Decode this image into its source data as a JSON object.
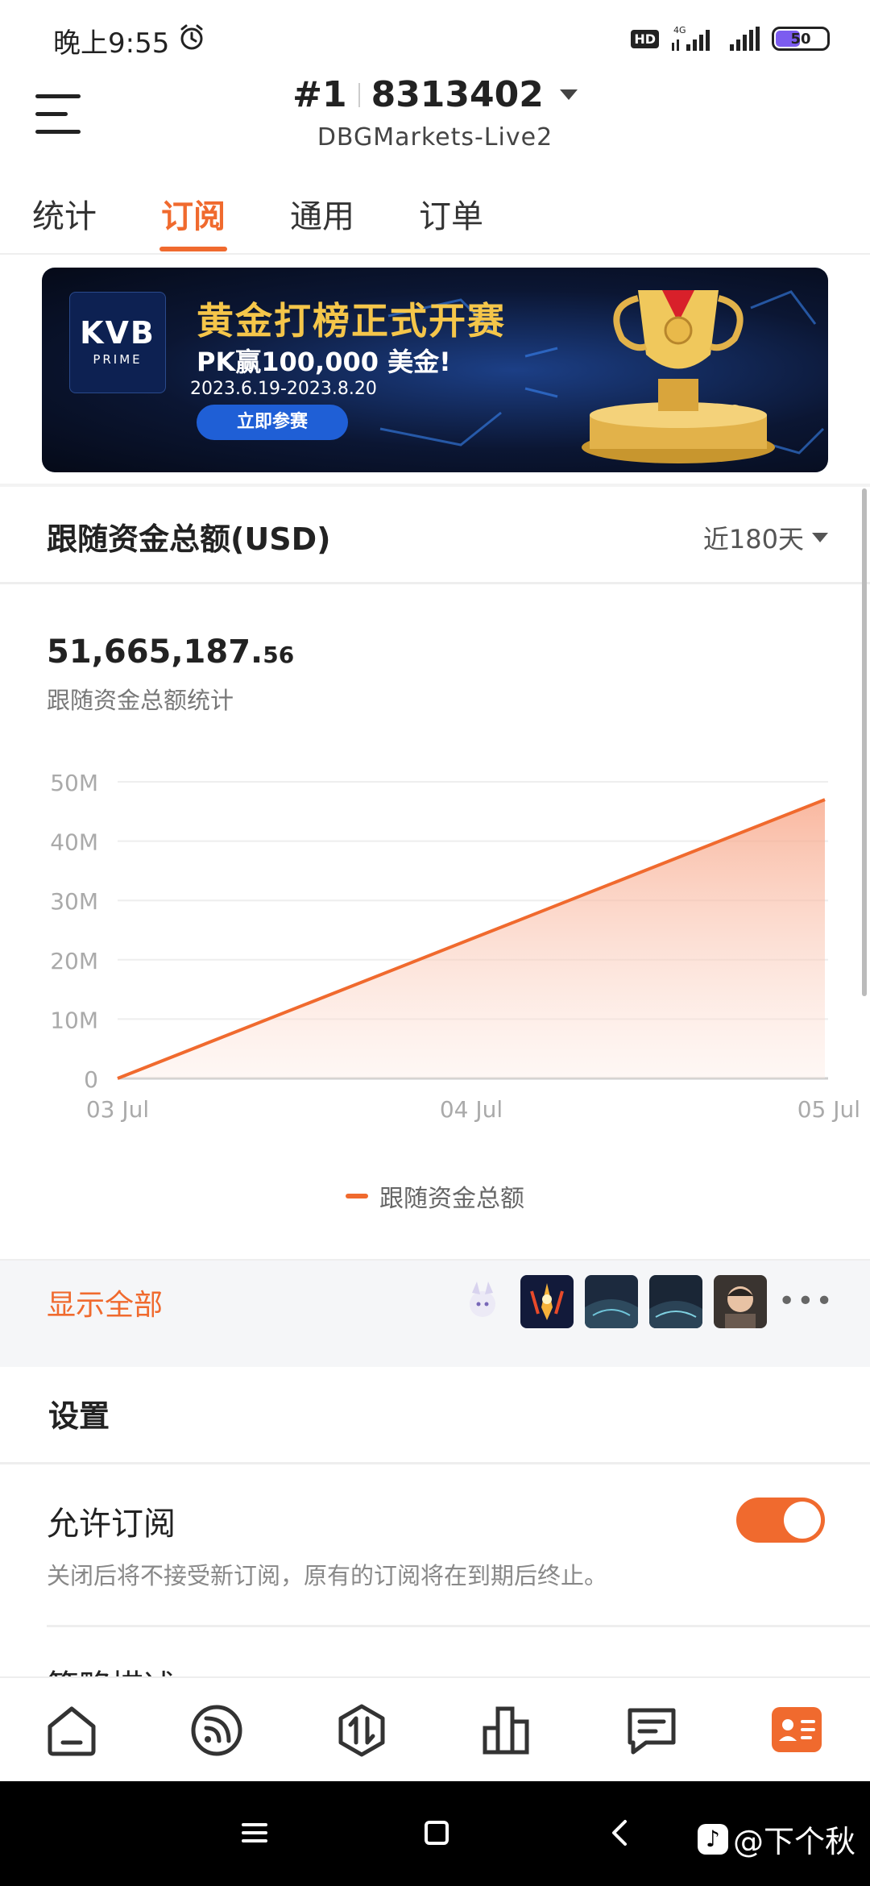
{
  "status_bar": {
    "time": "晚上9:55",
    "hd": "HD",
    "network": "4G",
    "battery": "50"
  },
  "header": {
    "rank": "#1",
    "account": "8313402",
    "server": "DBGMarkets-Live2"
  },
  "tabs": [
    {
      "label": "统计",
      "active": false
    },
    {
      "label": "订阅",
      "active": true
    },
    {
      "label": "通用",
      "active": false
    },
    {
      "label": "订单",
      "active": false
    }
  ],
  "banner": {
    "logo_main": "KVB",
    "logo_sub": "PRIME",
    "headline": "黄金打榜正式开赛",
    "subline": "PK赢100,000 美金!",
    "dates": "2023.6.19-2023.8.20",
    "cta": "立即参赛"
  },
  "card": {
    "title": "跟随资金总额(USD)",
    "range": "近180天",
    "total_main": "51,665,187.",
    "total_cents": "56",
    "total_label": "跟随资金总额统计"
  },
  "chart_data": {
    "type": "area",
    "categories": [
      "03 Jul",
      "04 Jul",
      "05 Jul"
    ],
    "series": [
      {
        "name": "跟随资金总额",
        "values": [
          0,
          23500000,
          47000000
        ]
      }
    ],
    "y_ticks": [
      "0",
      "10M",
      "20M",
      "30M",
      "40M",
      "50M"
    ],
    "ylim": [
      0,
      50000000
    ],
    "line_color": "#f06a2e",
    "grid": true,
    "legend_position": "bottom"
  },
  "showall": {
    "label": "显示全部",
    "more": "•••"
  },
  "settings": {
    "title": "设置",
    "allow_label": "允许订阅",
    "allow_desc": "关闭后将不接受新订阅，原有的订阅将在到期后终止。",
    "allow_on": true,
    "strategy_label": "策略描述"
  },
  "bottom_nav": [
    {
      "icon": "home-icon",
      "active": false
    },
    {
      "icon": "feed-icon",
      "active": false
    },
    {
      "icon": "trade-icon",
      "active": false
    },
    {
      "icon": "chart-bars-icon",
      "active": false
    },
    {
      "icon": "message-icon",
      "active": false
    },
    {
      "icon": "profile-card-icon",
      "active": true
    }
  ],
  "watermark": "@下个秋",
  "accent_color": "#f06a2e"
}
